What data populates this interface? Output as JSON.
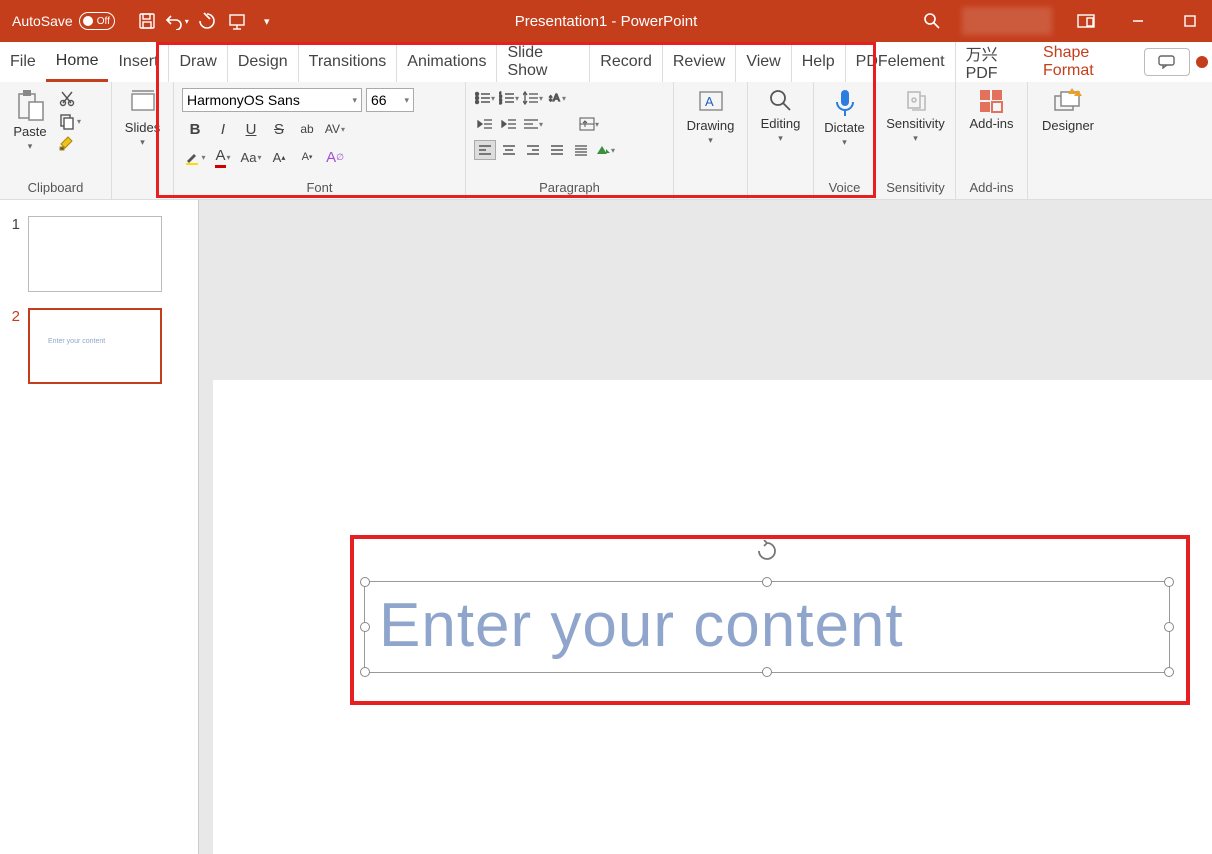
{
  "titlebar": {
    "autosave_label": "AutoSave",
    "autosave_state": "Off",
    "doc_title": "Presentation1  -  PowerPoint"
  },
  "tabs": {
    "file": "File",
    "home": "Home",
    "insert": "Insert",
    "draw": "Draw",
    "design": "Design",
    "transitions": "Transitions",
    "animations": "Animations",
    "slideshow": "Slide Show",
    "record": "Record",
    "review": "Review",
    "view": "View",
    "help": "Help",
    "pdfelement": "PDFelement",
    "wanxing": "万兴PDF",
    "shapeformat": "Shape Format"
  },
  "ribbon": {
    "clipboard": {
      "paste": "Paste",
      "label": "Clipboard"
    },
    "slides": {
      "slides": "Slides"
    },
    "font": {
      "name": "HarmonyOS Sans",
      "size": "66",
      "label": "Font"
    },
    "paragraph": {
      "label": "Paragraph"
    },
    "drawing": {
      "label": "Drawing"
    },
    "editing": {
      "label": "Editing"
    },
    "voice": {
      "dictate": "Dictate",
      "label": "Voice"
    },
    "sensitivity": {
      "btn": "Sensitivity",
      "label": "Sensitivity"
    },
    "addins": {
      "btn": "Add-ins",
      "label": "Add-ins"
    },
    "designer": {
      "label": "Designer"
    }
  },
  "thumbnails": {
    "slide1_num": "1",
    "slide2_num": "2",
    "slide2_preview": "Enter your content"
  },
  "slide": {
    "textbox_text": "Enter your content"
  },
  "colors": {
    "accent": "#c43e1c",
    "highlight": "#e62020",
    "placeholder_text": "#8fa5cc"
  }
}
